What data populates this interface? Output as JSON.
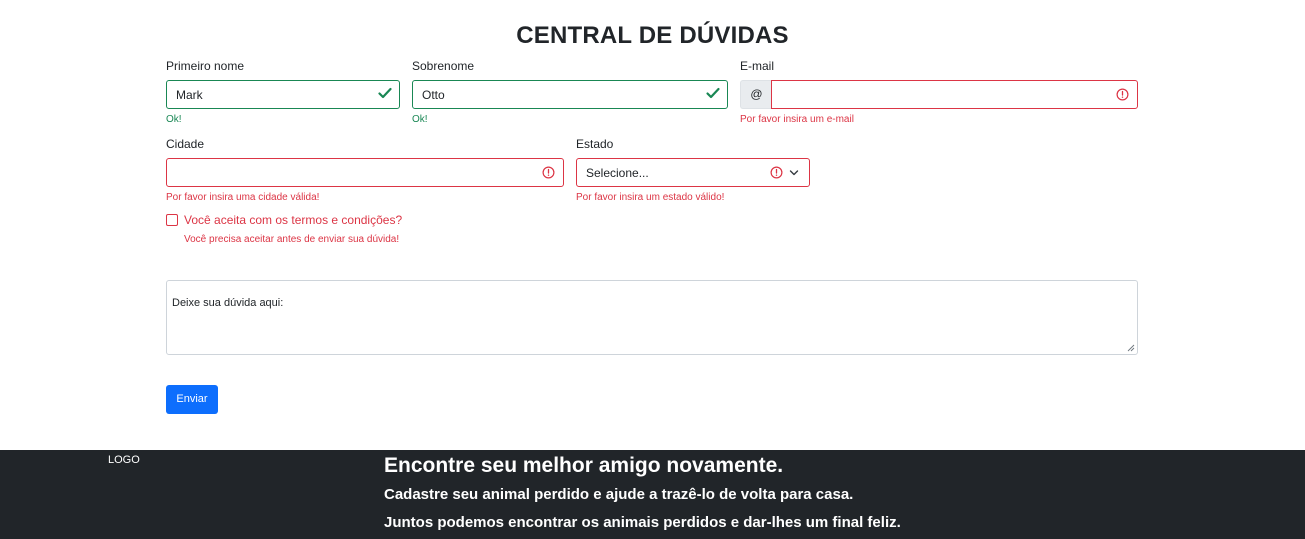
{
  "page": {
    "title": "CENTRAL DE DÚVIDAS"
  },
  "form": {
    "first_name": {
      "label": "Primeiro nome",
      "value": "Mark",
      "feedback": "Ok!",
      "state": "valid"
    },
    "last_name": {
      "label": "Sobrenome",
      "value": "Otto",
      "feedback": "Ok!",
      "state": "valid"
    },
    "email": {
      "label": "E-mail",
      "prefix": "@",
      "value": "",
      "feedback": "Por favor insira um e-mail",
      "state": "invalid"
    },
    "city": {
      "label": "Cidade",
      "value": "",
      "feedback": "Por favor insira uma cidade válida!",
      "state": "invalid"
    },
    "state": {
      "label": "Estado",
      "selected": "Selecione...",
      "feedback": "Por favor insira um estado válido!",
      "state": "invalid"
    },
    "terms": {
      "label": "Você aceita com os termos e condições?",
      "checked": false,
      "feedback": "Você precisa aceitar antes de enviar sua dúvida!"
    },
    "question": {
      "placeholder": "Deixe sua dúvida aqui:"
    },
    "submit_label": "Enviar"
  },
  "footer": {
    "logo": "LOGO",
    "heading": "Encontre seu melhor amigo novamente.",
    "line1": "Cadastre seu animal perdido e ajude a trazê-lo de volta para casa.",
    "line2": "Juntos podemos encontrar os animais perdidos e dar-lhes um final feliz."
  },
  "colors": {
    "valid": "#198754",
    "invalid": "#dc3545",
    "primary": "#0d6efd",
    "footer_bg": "#212529"
  },
  "icons": [
    "check-icon",
    "exclamation-circle-icon",
    "chevron-down-icon",
    "resize-grip-icon"
  ]
}
